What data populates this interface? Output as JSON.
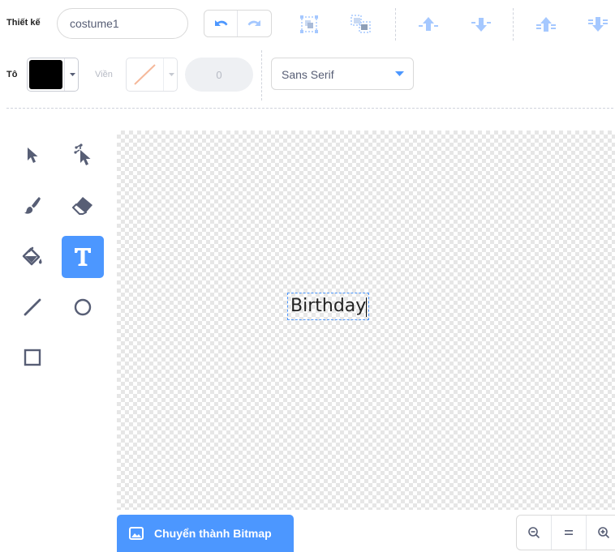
{
  "header": {
    "costume_label": "Thiết kế",
    "costume_name": "costume1"
  },
  "toolbar": {
    "undo_icon": "undo-icon",
    "redo_icon": "redo-icon",
    "group_icon": "group-icon",
    "ungroup_icon": "ungroup-icon",
    "forward_icon": "forward-icon",
    "backward_icon": "backward-icon",
    "front_icon": "bring-to-front-icon",
    "back_icon": "send-to-back-icon"
  },
  "properties": {
    "fill_label": "Tô",
    "fill_color": "#000000",
    "outline_label": "Viền",
    "outline_width": "0",
    "font": "Sans Serif"
  },
  "tools": [
    {
      "name": "select-tool",
      "icon": "arrow-pointer-icon"
    },
    {
      "name": "reshape-tool",
      "icon": "reshape-pointer-icon"
    },
    {
      "name": "brush-tool",
      "icon": "brush-icon"
    },
    {
      "name": "eraser-tool",
      "icon": "eraser-icon"
    },
    {
      "name": "fill-tool",
      "icon": "paint-bucket-icon"
    },
    {
      "name": "text-tool",
      "icon": "text-t-icon",
      "active": true
    },
    {
      "name": "line-tool",
      "icon": "line-icon"
    },
    {
      "name": "circle-tool",
      "icon": "circle-icon"
    },
    {
      "name": "rectangle-tool",
      "icon": "rectangle-icon"
    }
  ],
  "canvas": {
    "text": "Birthday"
  },
  "footer": {
    "convert_button": "Chuyển thành Bitmap",
    "zoom_out_icon": "zoom-out-icon",
    "zoom_reset_icon": "zoom-reset-icon",
    "zoom_in_icon": "zoom-in-icon"
  },
  "colors": {
    "accent": "#4c97ff",
    "accent_light": "#a5c8ff",
    "text": "#575e75",
    "disabled": "#b6bac4"
  }
}
